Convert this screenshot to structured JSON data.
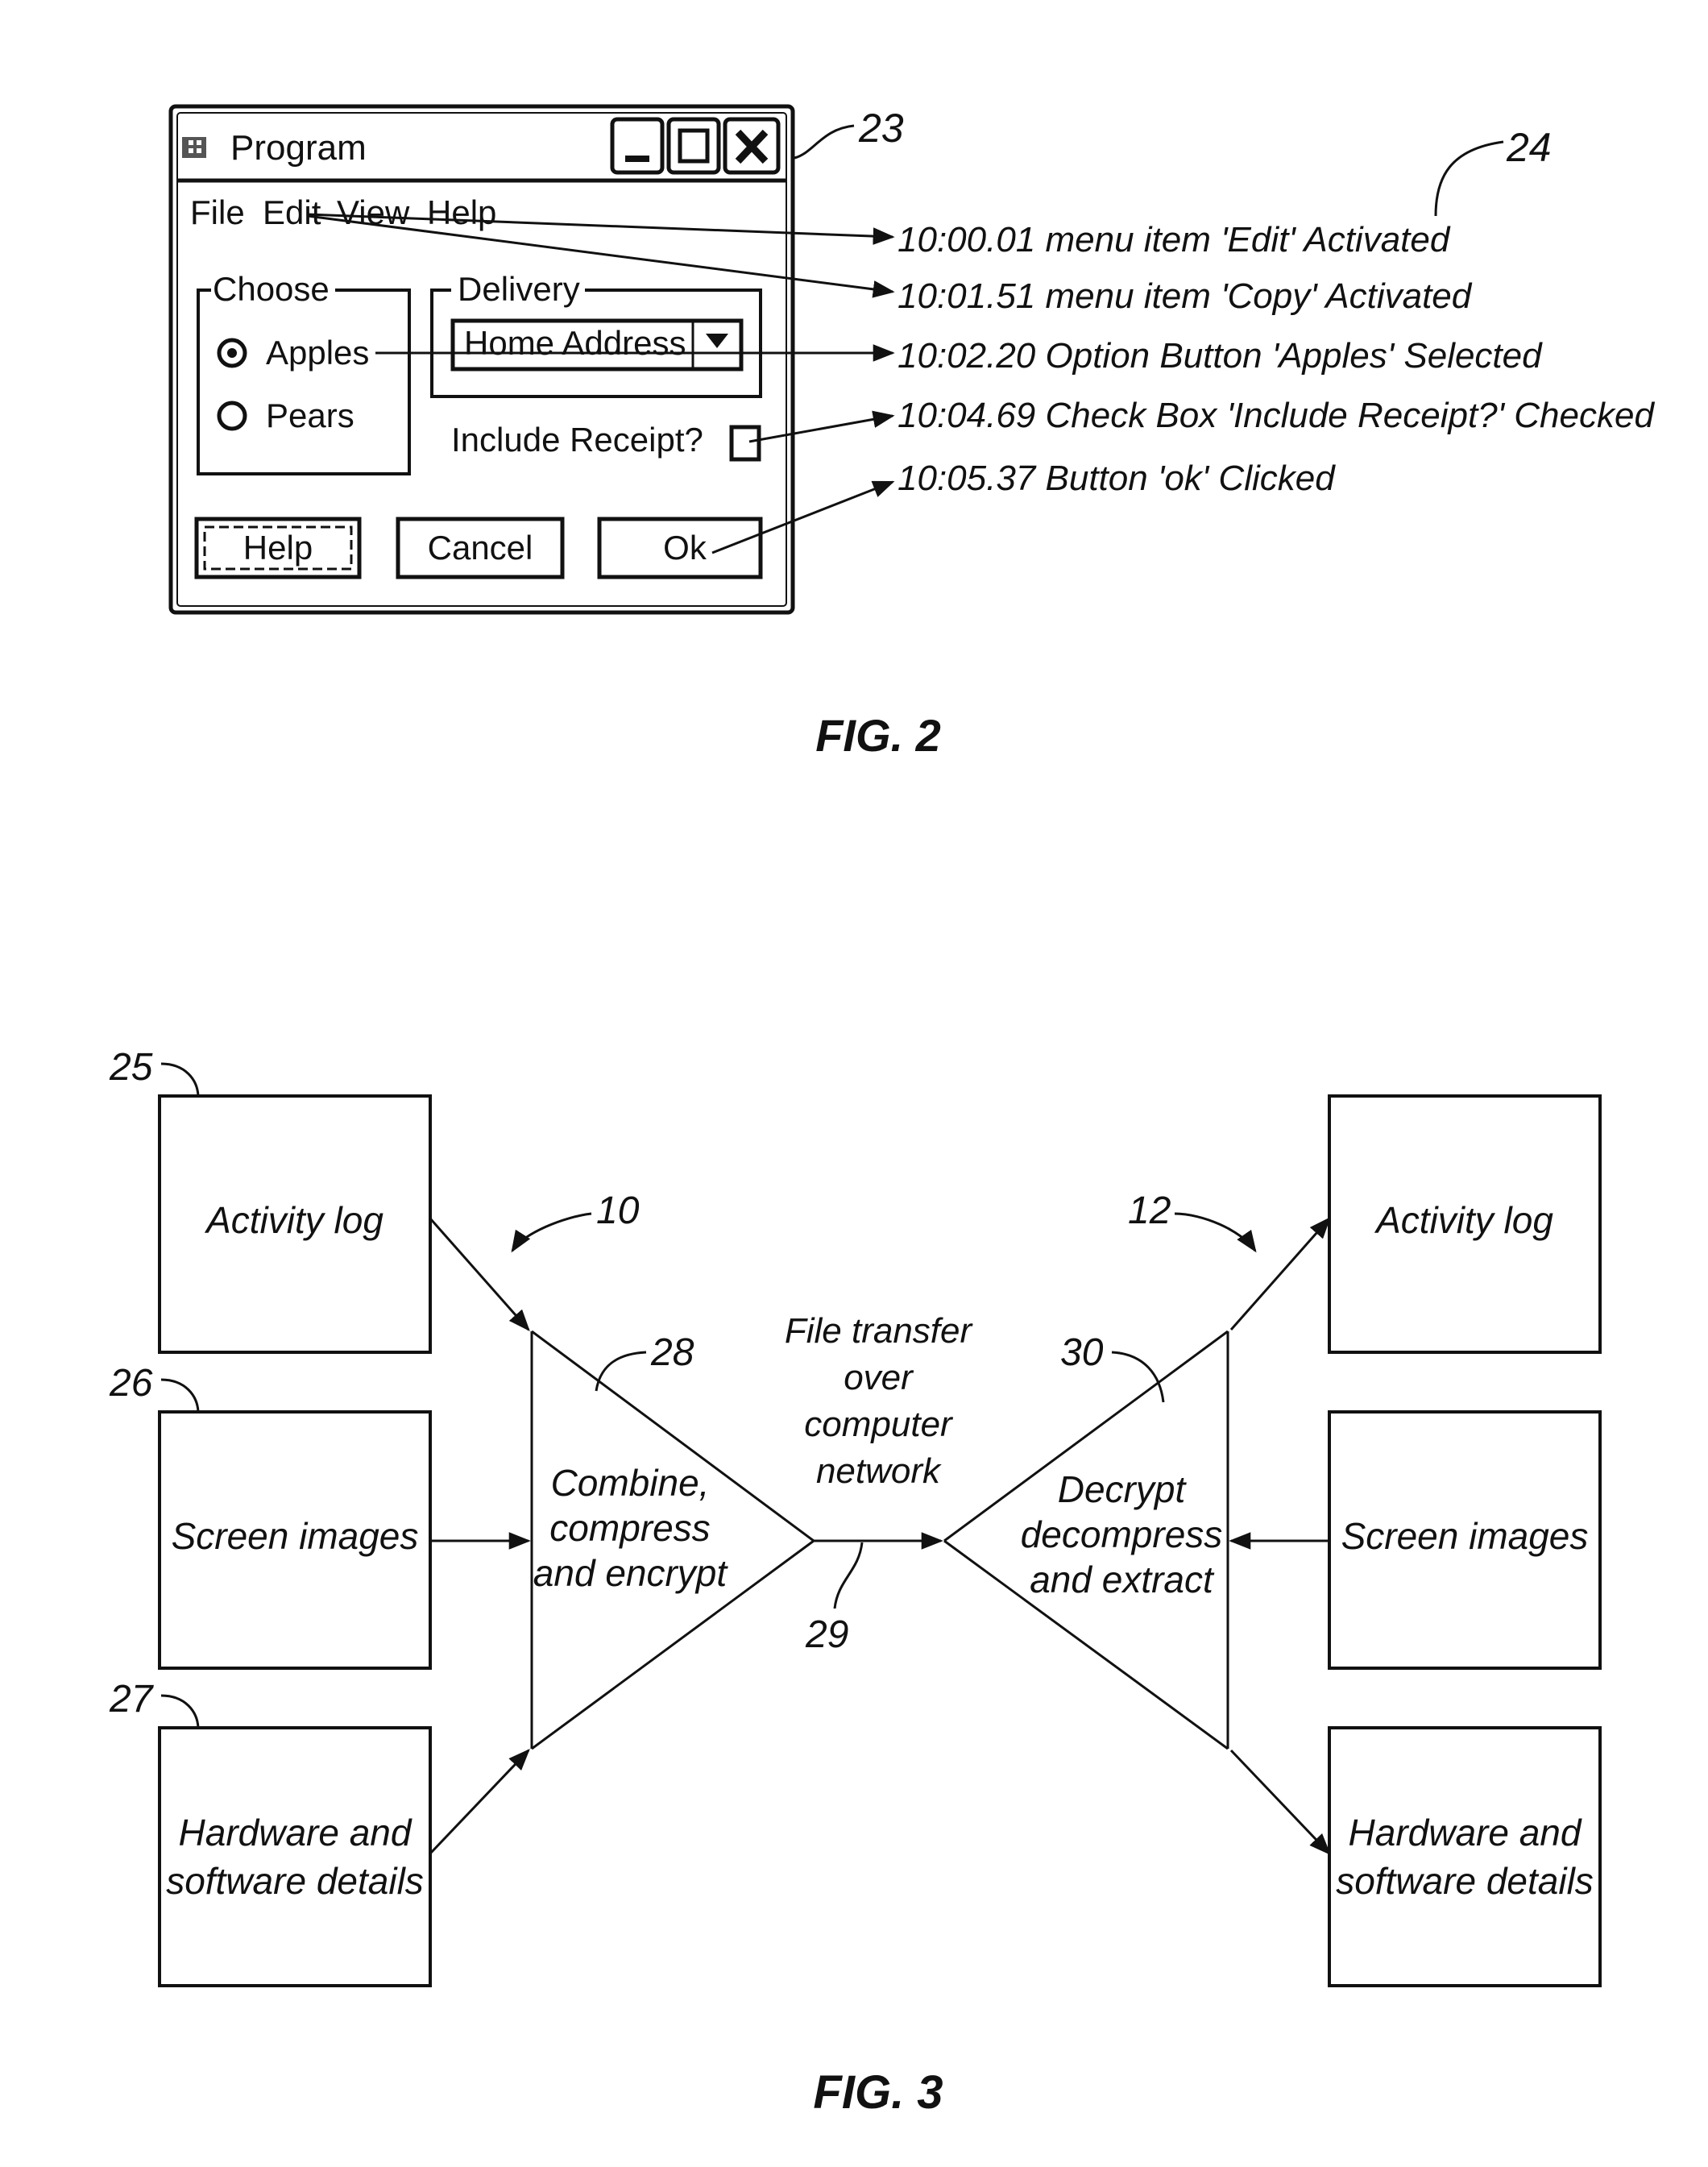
{
  "fig2": {
    "caption": "FIG. 2",
    "window": {
      "title": "Program",
      "ref_label": "23",
      "menu": [
        "File",
        "Edit",
        "View",
        "Help"
      ],
      "choose_group": {
        "label": "Choose",
        "options": [
          {
            "label": "Apples",
            "selected": true
          },
          {
            "label": "Pears",
            "selected": false
          }
        ]
      },
      "delivery_group": {
        "label": "Delivery",
        "selected_value": "Home Address"
      },
      "checkbox": {
        "label": "Include Receipt?",
        "checked": false
      },
      "buttons": [
        "Help",
        "Cancel",
        "Ok"
      ]
    },
    "log": {
      "ref_label": "24",
      "entries": [
        "10:00.01 menu item 'Edit' Activated",
        "10:01.51 menu item 'Copy' Activated",
        "10:02.20 Option Button 'Apples' Selected",
        "10:04.69 Check Box 'Include Receipt?' Checked",
        "10:05.37 Button 'ok' Clicked"
      ]
    }
  },
  "fig3": {
    "caption": "FIG. 3",
    "left_inputs": [
      {
        "ref": "25",
        "text": [
          "Activity log"
        ]
      },
      {
        "ref": "26",
        "text": [
          "Screen images"
        ]
      },
      {
        "ref": "27",
        "text": [
          "Hardware and",
          "software details"
        ]
      }
    ],
    "right_outputs": [
      {
        "text": [
          "Activity log"
        ]
      },
      {
        "text": [
          "Screen images"
        ]
      },
      {
        "text": [
          "Hardware and",
          "software details"
        ]
      }
    ],
    "left_process": {
      "ref": "28",
      "group_ref": "10",
      "text": [
        "Combine,",
        "compress",
        "and encrypt"
      ]
    },
    "right_process": {
      "ref": "30",
      "group_ref": "12",
      "text": [
        "Decrypt",
        "decompress",
        "and extract"
      ]
    },
    "transfer": {
      "ref": "29",
      "text": [
        "File transfer",
        "over",
        "computer",
        "network"
      ]
    }
  }
}
